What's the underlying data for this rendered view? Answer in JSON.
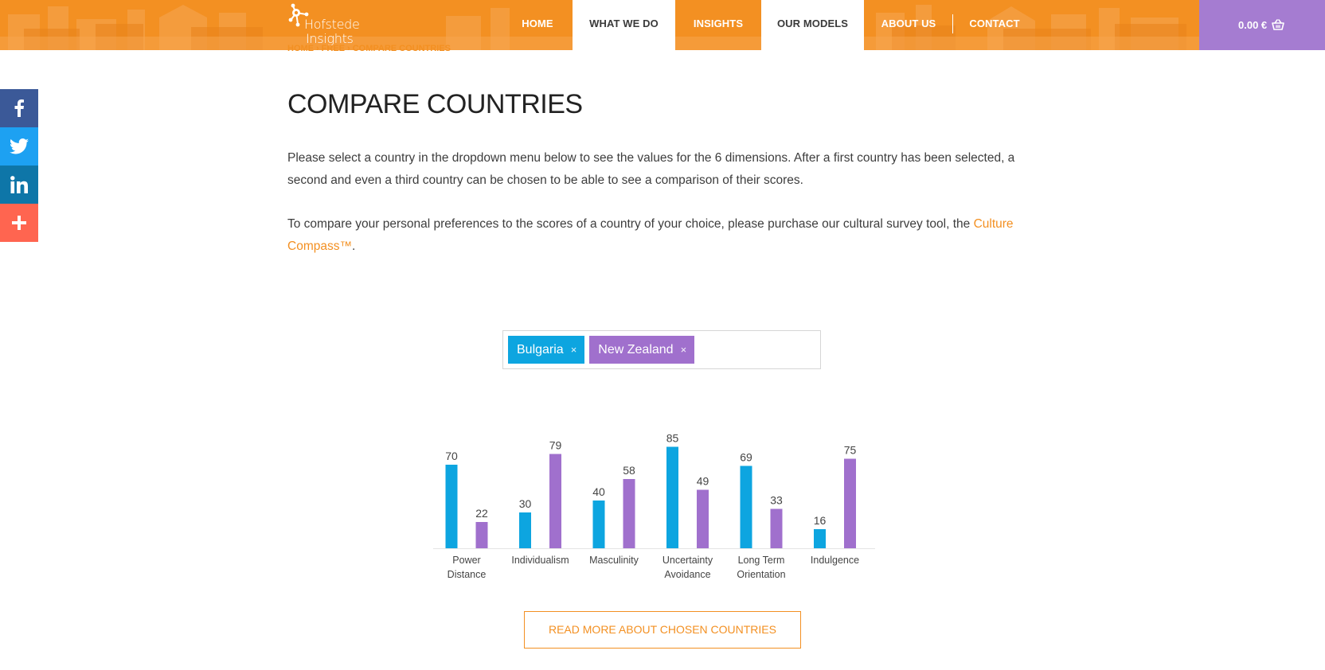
{
  "header": {
    "logo_line1": "Hofstede",
    "logo_line2": "Insights",
    "nav": [
      {
        "label": "HOME"
      },
      {
        "label": "WHAT WE DO"
      },
      {
        "label": "INSIGHTS"
      },
      {
        "label": "OUR MODELS"
      },
      {
        "label": "ABOUT US"
      },
      {
        "label": "CONTACT"
      }
    ],
    "cart_total": "0.00 €",
    "colors": {
      "primary": "#f39022",
      "cart": "#a57cd1"
    }
  },
  "breadcrumb": [
    "HOME",
    "FREE",
    "COMPARE COUNTRIES"
  ],
  "social": [
    {
      "icon": "facebook-icon"
    },
    {
      "icon": "twitter-icon"
    },
    {
      "icon": "linkedin-icon"
    },
    {
      "icon": "plus-icon"
    }
  ],
  "main": {
    "title": "COMPARE COUNTRIES",
    "paragraph1": "Please select a country in the dropdown menu below to see the values for the 6 dimensions. After a first country has been selected, a second and even a third country can be chosen to be able to see a comparison of their scores.",
    "paragraph2_before": "To compare your personal preferences to the scores of a country of your choice, please purchase our cultural survey tool, the ",
    "paragraph2_link": "Culture Compass™",
    "paragraph2_after": "."
  },
  "selector": {
    "tags": [
      {
        "label": "Bulgaria",
        "color": "#0da5e0"
      },
      {
        "label": "New Zealand",
        "color": "#a070cd"
      }
    ],
    "remove_glyph": "×"
  },
  "chart_data": {
    "type": "bar",
    "categories": [
      "Power Distance",
      "Individualism",
      "Masculinity",
      "Uncertainty Avoidance",
      "Long Term Orientation",
      "Indulgence"
    ],
    "series": [
      {
        "name": "Bulgaria",
        "color": "#0da5e0",
        "values": [
          70,
          30,
          40,
          85,
          69,
          16
        ]
      },
      {
        "name": "New Zealand",
        "color": "#a070cd",
        "values": [
          22,
          79,
          58,
          49,
          33,
          75
        ]
      }
    ],
    "ylim": [
      0,
      100
    ],
    "grid": false,
    "data_labels": true
  },
  "cta": {
    "label": "READ MORE ABOUT CHOSEN COUNTRIES"
  }
}
